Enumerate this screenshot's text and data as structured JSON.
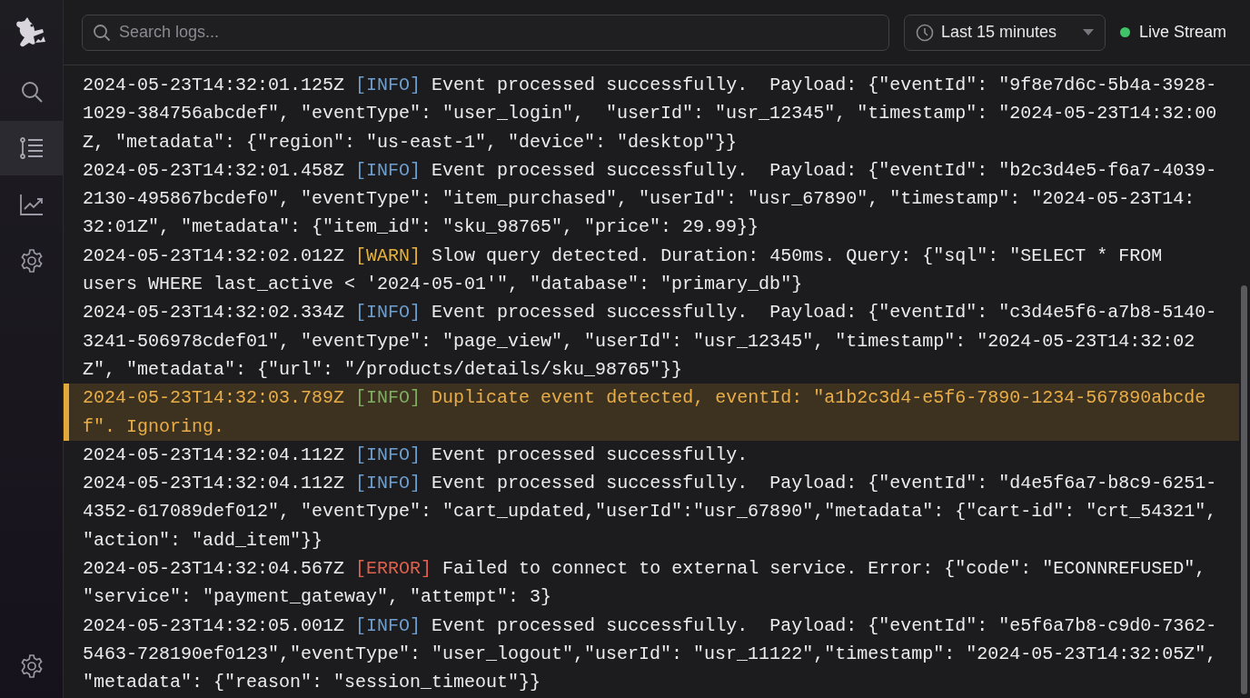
{
  "sidebar": {
    "items": [
      {
        "kind": "search",
        "selected": false
      },
      {
        "kind": "logs",
        "selected": true
      },
      {
        "kind": "metrics",
        "selected": false
      },
      {
        "kind": "settings",
        "selected": false
      }
    ],
    "footer_item": {
      "kind": "settings",
      "selected": false
    }
  },
  "toolbar": {
    "search": {
      "placeholder": "Search logs..."
    },
    "time_range": {
      "value": "Last 15 minutes"
    },
    "live_stream": {
      "label": "Live Stream",
      "on": true
    }
  },
  "logs": [
    {
      "timestamp": "2024-05-23T14:32:01.125Z",
      "level": "[INFO]",
      "kind": "info",
      "highlighted": false,
      "lines": [
        "Event processed successfully.  Payload: {\"eventId\": \"9f8e7d6c-5b4a-3928-",
        "1029-384756abcdef\", \"eventType\": \"user_login\",  \"userId\": \"usr_12345\", \"timestamp\": \"2024-05-23T14:32:00",
        "Z, \"metadata\": {\"region\": \"us-east-1\", \"device\": \"desktop\"}}"
      ]
    },
    {
      "timestamp": "2024-05-23T14:32:01.458Z",
      "level": "[INFO]",
      "kind": "info",
      "highlighted": false,
      "lines": [
        "Event processed successfully.  Payload: {\"eventId\": \"b2c3d4e5-f6a7-4039-",
        "2130-495867bcdef0\", \"eventType\": \"item_purchased\", \"userId\": \"usr_67890\", \"timestamp\": \"2024-05-23T14:",
        "32:01Z\", \"metadata\": {\"item_id\": \"sku_98765\", \"price\": 29.99}}"
      ]
    },
    {
      "timestamp": "2024-05-23T14:32:02.012Z",
      "level": "[WARN]",
      "kind": "warn",
      "highlighted": false,
      "lines": [
        "Slow query detected. Duration: 450ms. Query: {\"sql\": \"SELECT * FROM",
        "users WHERE last_active < '2024-05-01'\", \"database\": \"primary_db\"}"
      ]
    },
    {
      "timestamp": "2024-05-23T14:32:02.334Z",
      "level": "[INFO]",
      "kind": "info",
      "highlighted": false,
      "lines": [
        "Event processed successfully.  Payload: {\"eventId\": \"c3d4e5f6-a7b8-5140-",
        "3241-506978cdef01\", \"eventType\": \"page_view\", \"userId\": \"usr_12345\", \"timestamp\": \"2024-05-23T14:32:02",
        "Z\", \"metadata\": {\"url\": \"/products/details/sku_98765\"}}"
      ]
    },
    {
      "timestamp": "2024-05-23T14:32:03.789Z",
      "level": "[INFO]",
      "kind": "info",
      "highlighted": true,
      "lines": [
        "Duplicate event detected, eventId: \"a1b2c3d4-e5f6-7890-1234-567890abcde",
        "f\". Ignoring."
      ]
    },
    {
      "timestamp": "2024-05-23T14:32:04.112Z",
      "level": "[INFO]",
      "kind": "info",
      "highlighted": false,
      "lines": [
        "Event processed successfully."
      ]
    },
    {
      "timestamp": "2024-05-23T14:32:04.112Z",
      "level": "[INFO]",
      "kind": "info",
      "highlighted": false,
      "lines": [
        "Event processed successfully.  Payload: {\"eventId\": \"d4e5f6a7-b8c9-6251-",
        "4352-617089def012\", \"eventType\": \"cart_updated,\"userId\":\"usr_67890\",\"metadata\": {\"cart-id\": \"crt_54321\",",
        "\"action\": \"add_item\"}}"
      ]
    },
    {
      "timestamp": "2024-05-23T14:32:04.567Z",
      "level": "[ERROR]",
      "kind": "error",
      "highlighted": false,
      "lines": [
        "Failed to connect to external service. Error: {\"code\": \"ECONNREFUSED\",",
        "\"service\": \"payment_gateway\", \"attempt\": 3}"
      ]
    },
    {
      "timestamp": "2024-05-23T14:32:05.001Z",
      "level": "[INFO]",
      "kind": "info",
      "highlighted": false,
      "lines": [
        "Event processed successfully.  Payload: {\"eventId\": \"e5f6a7b8-c9d0-7362-",
        "5463-728190ef0123\",\"eventType\": \"user_logout\",\"userId\": \"usr_11122\",\"timestamp\": \"2024-05-23T14:32:05Z\",",
        "\"metadata\": {\"reason\": \"session_timeout\"}}"
      ]
    }
  ]
}
